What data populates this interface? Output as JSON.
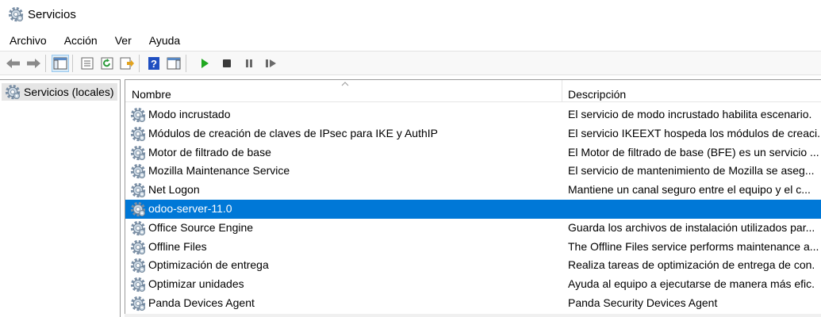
{
  "window": {
    "title": "Servicios",
    "icon": "services-gear-icon"
  },
  "menu": [
    "Archivo",
    "Acción",
    "Ver",
    "Ayuda"
  ],
  "toolbar": {
    "buttons": [
      "back-arrow-icon",
      "forward-arrow-icon",
      "show-hide-tree-icon",
      "properties-icon",
      "refresh-icon",
      "export-list-icon",
      "help-icon",
      "show-action-pane-icon",
      "start-service-icon",
      "stop-service-icon",
      "pause-service-icon",
      "restart-service-icon"
    ]
  },
  "tree": {
    "root": "Servicios (locales)"
  },
  "columns": {
    "name": "Nombre",
    "description": "Descripción"
  },
  "services": [
    {
      "name": "Modo incrustado",
      "description": "El servicio de modo incrustado habilita escenario."
    },
    {
      "name": "Módulos de creación de claves de IPsec para IKE y AuthIP",
      "description": "El servicio IKEEXT hospeda los módulos de creaci."
    },
    {
      "name": "Motor de filtrado de base",
      "description": "El Motor de filtrado de base (BFE) es un servicio ..."
    },
    {
      "name": "Mozilla Maintenance Service",
      "description": "El servicio de mantenimiento de Mozilla se aseg..."
    },
    {
      "name": "Net Logon",
      "description": "Mantiene un canal seguro entre el equipo y el c..."
    },
    {
      "name": "odoo-server-11.0",
      "description": "",
      "selected": true
    },
    {
      "name": "Office  Source Engine",
      "description": "Guarda los archivos de instalación utilizados par..."
    },
    {
      "name": "Offline Files",
      "description": "The Offline Files service performs maintenance a..."
    },
    {
      "name": "Optimización de entrega",
      "description": "Realiza tareas de optimización de entrega de con."
    },
    {
      "name": "Optimizar unidades",
      "description": "Ayuda al equipo a ejecutarse de manera más efic."
    },
    {
      "name": "Panda Devices Agent",
      "description": "Panda Security Devices Agent"
    }
  ],
  "colors": {
    "selection": "#0078d7",
    "play": "#1fa81f",
    "help": "#1f4fc1"
  }
}
